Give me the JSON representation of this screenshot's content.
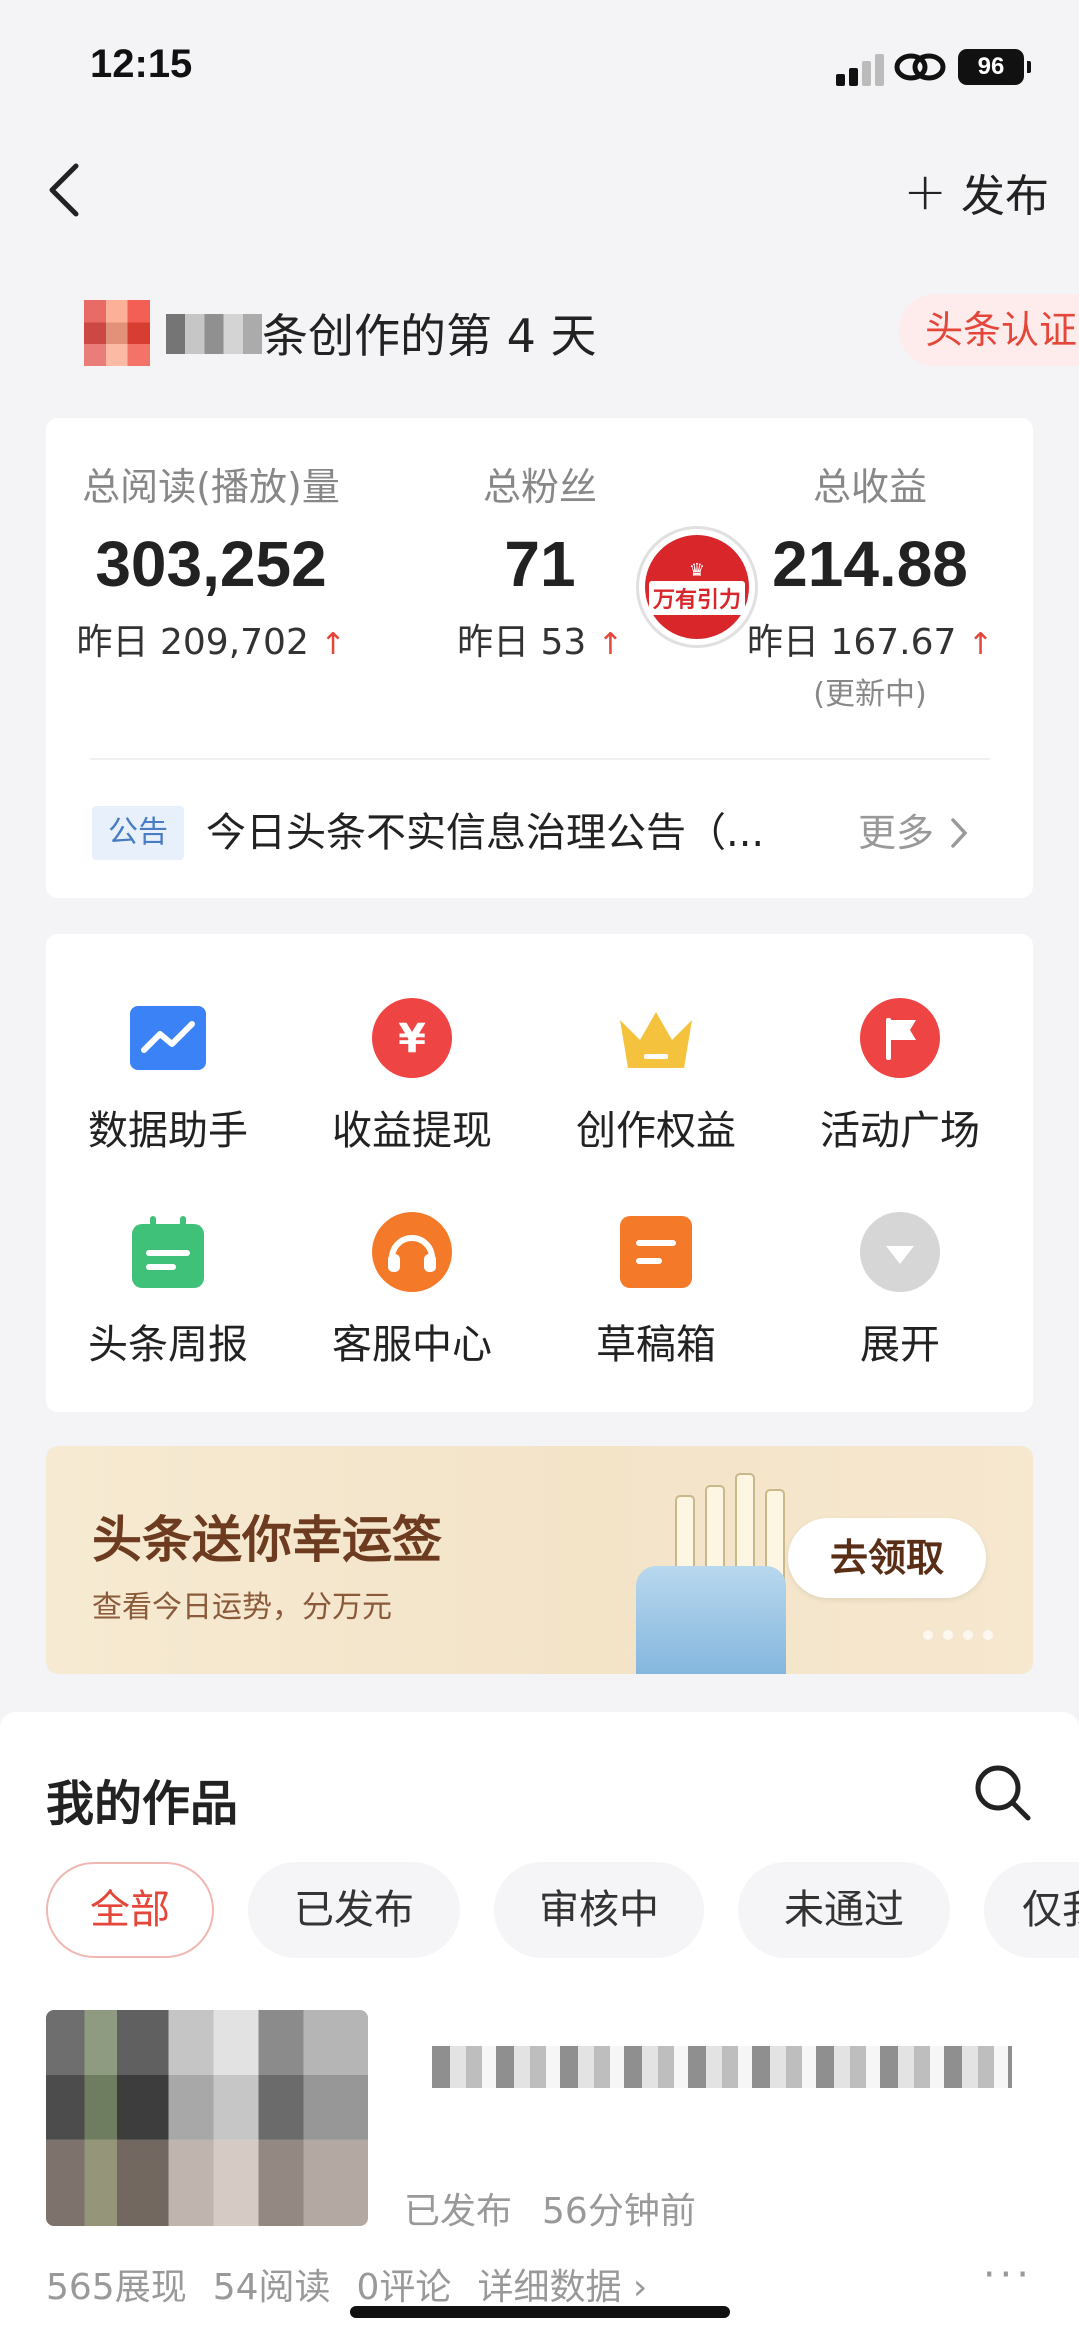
{
  "status": {
    "time": "12:15",
    "battery": "96"
  },
  "nav": {
    "publish": "发布"
  },
  "creator": {
    "text": "条创作的第 4 天",
    "cert": "头条认证"
  },
  "stats": [
    {
      "label": "总阅读(播放)量",
      "value": "303,252",
      "yesterday": "昨日 209,702"
    },
    {
      "label": "总粉丝",
      "value": "71",
      "yesterday": "昨日 53"
    },
    {
      "label": "总收益",
      "value": "214.88",
      "yesterday": "昨日 167.67",
      "note": "(更新中)"
    }
  ],
  "stamp": {
    "title": "万有引力"
  },
  "notice": {
    "badge": "公告",
    "text": "今日头条不实信息治理公告（...",
    "more": "更多"
  },
  "tools": [
    {
      "label": "数据助手",
      "icon": "data-assistant-icon"
    },
    {
      "label": "收益提现",
      "icon": "yuan-icon"
    },
    {
      "label": "创作权益",
      "icon": "crown-icon"
    },
    {
      "label": "活动广场",
      "icon": "flag-icon"
    },
    {
      "label": "头条周报",
      "icon": "calendar-icon"
    },
    {
      "label": "客服中心",
      "icon": "headset-icon"
    },
    {
      "label": "草稿箱",
      "icon": "draft-icon"
    },
    {
      "label": "展开",
      "icon": "expand-icon"
    }
  ],
  "banner": {
    "title": "头条送你幸运签",
    "subtitle": "查看今日运势，分万元",
    "button": "去领取"
  },
  "works": {
    "title": "我的作品",
    "tabs": [
      "全部",
      "已发布",
      "审核中",
      "未通过",
      "仅我"
    ],
    "active_tab": "全部",
    "item": {
      "status": "已发布",
      "time": "56分钟前",
      "impressions": "565展现",
      "reads": "54阅读",
      "comments": "0评论",
      "details": "详细数据 ›",
      "more": "···"
    }
  },
  "colors": {
    "accent": "#e5463a",
    "blue": "#3b82f6",
    "orange": "#f47a2a",
    "gold": "#f5c23e",
    "green": "#3fc17a"
  }
}
